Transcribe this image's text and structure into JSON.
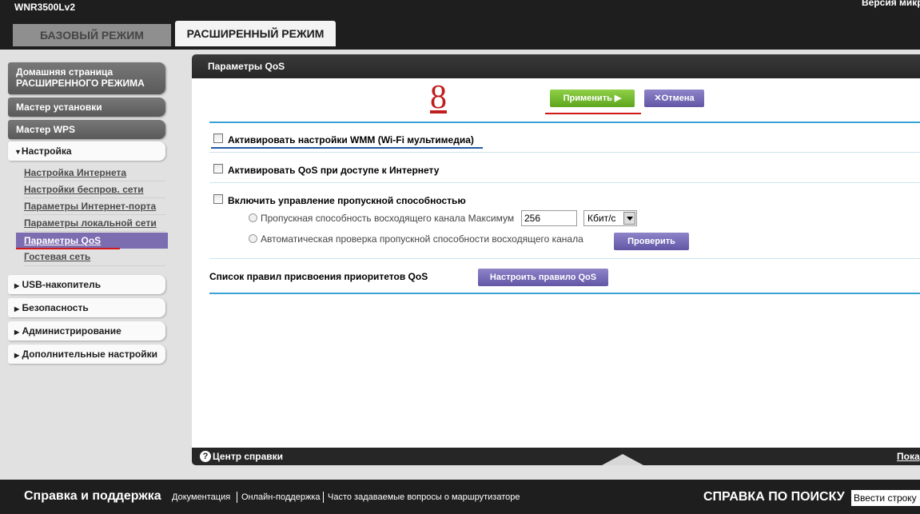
{
  "header": {
    "model": "WNR3500Lv2",
    "firmware_label": "Версия микр",
    "tabs": [
      {
        "label": "БАЗОВЫЙ РЕЖИМ",
        "active": false
      },
      {
        "label": "РАСШИРЕННЫЙ РЕЖИМ",
        "active": true
      }
    ]
  },
  "sidebar": {
    "home_line1": "Домашняя страница",
    "home_line2": "РАСШИРЕННОГО РЕЖИМА",
    "setup_wizard": "Мастер установки",
    "wps_wizard": "Мастер WPS",
    "setup_group": "Настройка",
    "setup_items": [
      "Настройка Интернета",
      "Настройки беспров. сети",
      "Параметры Интернет-порта",
      "Параметры локальной сети",
      "Параметры QoS",
      "Гостевая сеть"
    ],
    "groups": [
      "USB-накопитель",
      "Безопасность",
      "Администрирование",
      "Дополнительные настройки"
    ],
    "arrow_collapsed": "▶",
    "arrow_expanded": "▼"
  },
  "panel": {
    "title": "Параметры QoS",
    "apply_label": "Применить ▶",
    "cancel_label": "✕Отмена",
    "step_number": "8",
    "wmm_label": "Активировать настройки WMM (Wi-Fi мультимедиа)",
    "wmm_checked": false,
    "qos_internet_label": "Активировать QoS при доступе к Интернету",
    "qos_internet_checked": false,
    "bandwidth_control_label": "Включить управление пропускной способностью",
    "bandwidth_control_checked": false,
    "uplink_max_label": "Пропускная способность восходящего канала Максимум",
    "uplink_value": "256",
    "unit_selected": "Кбит/с",
    "auto_check_label": "Автоматическая проверка пропускной способности восходящего канала",
    "check_button": "Проверить",
    "rules_list_label": "Список правил присвоения приоритетов QoS",
    "configure_rule_button": "Настроить правило QoS",
    "footer_help": "Центр справки",
    "footer_show": "Пока"
  },
  "bottombar": {
    "title": "Справка и поддержка",
    "links": [
      "Документация",
      "Онлайн-поддержка",
      "Часто задаваемые вопросы о маршрутизаторе"
    ],
    "search_title": "СПРАВКА ПО ПОИСКУ",
    "search_value": "Ввести строку"
  },
  "colors": {
    "accent_purple": "#7c6cb0",
    "apply_green": "#6eb52a",
    "divider_blue": "#3aa3d6",
    "annotation_red": "#d01818"
  }
}
